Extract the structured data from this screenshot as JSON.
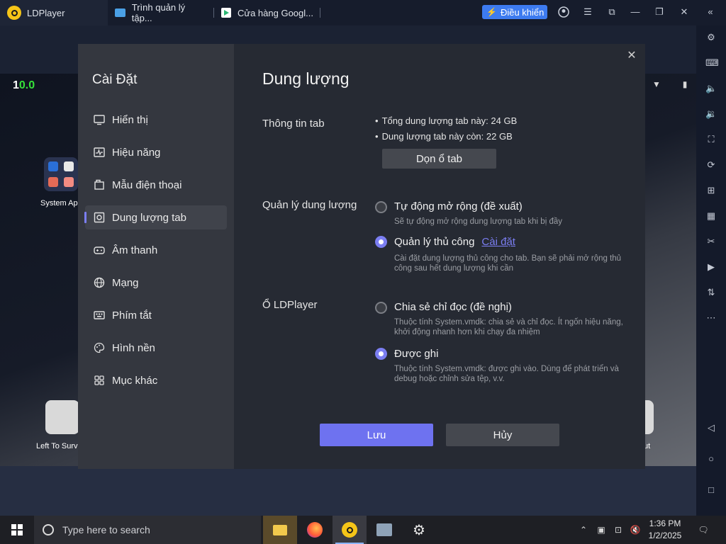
{
  "titlebar": {
    "tabs": [
      {
        "label": "LDPlayer",
        "icon": "ldplayer-logo-icon"
      },
      {
        "label": "Trình quản lý tập...",
        "icon": "folder-icon"
      },
      {
        "label": "Cửa hàng Googl...",
        "icon": "play-store-icon"
      }
    ],
    "control_button": "Điều khiển"
  },
  "android": {
    "status_time_prefix": "1",
    "status_time_highlight": "0.0",
    "desktop_icons": [
      "System App",
      "Left To Surv",
      "ut"
    ]
  },
  "dialog": {
    "title": "Cài Đặt",
    "nav": [
      {
        "label": "Hiển thị",
        "icon": "monitor-icon"
      },
      {
        "label": "Hiệu năng",
        "icon": "performance-icon"
      },
      {
        "label": "Mẫu điện thoại",
        "icon": "phone-model-icon"
      },
      {
        "label": "Dung lượng tab",
        "icon": "storage-icon",
        "active": true
      },
      {
        "label": "Âm thanh",
        "icon": "gamepad-icon"
      },
      {
        "label": "Mạng",
        "icon": "globe-icon"
      },
      {
        "label": "Phím tắt",
        "icon": "keyboard-icon"
      },
      {
        "label": "Hình nền",
        "icon": "palette-icon"
      },
      {
        "label": "Mục khác",
        "icon": "grid-icon"
      }
    ],
    "section_title": "Dung lượng",
    "tab_info": {
      "label": "Thông tin tab",
      "total": "Tổng dung lượng tab này: 24 GB",
      "remaining": "Dung lượng tab này còn: 22 GB",
      "clean_button": "Dọn ổ tab"
    },
    "storage_mgmt": {
      "label": "Quản lý dung lượng",
      "auto_label": "Tự động mở rộng (đề xuất)",
      "auto_desc": "Sẽ tự động mở rộng dung lượng tab khi bị đầy",
      "manual_label": "Quản lý thủ công",
      "manual_link": "Cài đặt",
      "manual_desc": "Cài đặt dung lượng thủ công cho tab. Bạn sẽ phải mở rộng thủ công sau hết dung lượng khi cần"
    },
    "ld_drive": {
      "label": "Ổ LDPlayer",
      "readonly_label": "Chia sẻ chỉ đọc (đề nghị)",
      "readonly_desc": "Thuộc tính System.vmdk: chia sẻ và chỉ đọc. Ít ngốn hiệu năng, khởi động nhanh hơn khi chạy đa nhiệm",
      "writable_label": "Được ghi",
      "writable_desc": "Thuộc tính System.vmdk: được ghi vào. Dùng để phát triển và debug hoặc chỉnh sửa tệp, v.v."
    },
    "save_button": "Lưu",
    "cancel_button": "Hủy"
  },
  "taskbar": {
    "search_placeholder": "Type here to search",
    "time": "1:36 PM",
    "date": "1/2/2025"
  },
  "colors": {
    "accent": "#7b7ef2",
    "save": "#6e72f0",
    "control": "#3d7bf0"
  }
}
